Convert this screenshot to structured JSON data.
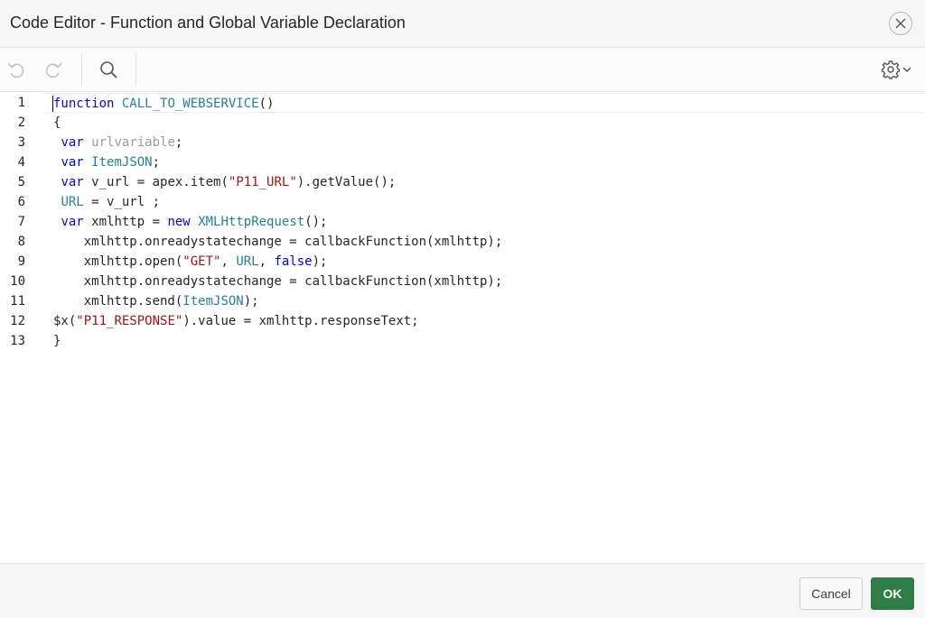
{
  "dialog": {
    "title": "Code Editor - Function and Global Variable Declaration"
  },
  "toolbar": {
    "undo_icon": "undo-icon",
    "redo_icon": "redo-icon",
    "search_icon": "search-icon",
    "settings_icon": "gear-icon"
  },
  "editor": {
    "line_numbers": [
      "1",
      "2",
      "3",
      "4",
      "5",
      "6",
      "7",
      "8",
      "9",
      "10",
      "11",
      "12",
      "13"
    ],
    "lines": [
      [
        {
          "t": "function",
          "c": "kw"
        },
        {
          "t": " "
        },
        {
          "t": "CALL_TO_WEBSERVICE",
          "c": "fn"
        },
        {
          "t": "()"
        }
      ],
      [
        {
          "t": "{"
        }
      ],
      [
        {
          "t": " "
        },
        {
          "t": "var",
          "c": "kw"
        },
        {
          "t": " "
        },
        {
          "t": "urlvariable",
          "c": "dim"
        },
        {
          "t": ";"
        }
      ],
      [
        {
          "t": " "
        },
        {
          "t": "var",
          "c": "kw"
        },
        {
          "t": " "
        },
        {
          "t": "ItemJSON",
          "c": "fn"
        },
        {
          "t": ";"
        }
      ],
      [
        {
          "t": " "
        },
        {
          "t": "var",
          "c": "kw"
        },
        {
          "t": " v_url = apex.item("
        },
        {
          "t": "\"P11_URL\"",
          "c": "str"
        },
        {
          "t": ").getValue();"
        }
      ],
      [
        {
          "t": " "
        },
        {
          "t": "URL",
          "c": "fn"
        },
        {
          "t": " = v_url ;"
        }
      ],
      [
        {
          "t": " "
        },
        {
          "t": "var",
          "c": "kw"
        },
        {
          "t": " xmlhttp = "
        },
        {
          "t": "new",
          "c": "kw"
        },
        {
          "t": " "
        },
        {
          "t": "XMLHttpRequest",
          "c": "fn"
        },
        {
          "t": "();"
        }
      ],
      [
        {
          "t": "    xmlhttp.onreadystatechange = callbackFunction(xmlhttp);"
        }
      ],
      [
        {
          "t": "    xmlhttp.open("
        },
        {
          "t": "\"GET\"",
          "c": "str"
        },
        {
          "t": ", "
        },
        {
          "t": "URL",
          "c": "fn"
        },
        {
          "t": ", "
        },
        {
          "t": "false",
          "c": "kw"
        },
        {
          "t": ");"
        }
      ],
      [
        {
          "t": "    xmlhttp.onreadystatechange = callbackFunction(xmlhttp);"
        }
      ],
      [
        {
          "t": "    xmlhttp.send("
        },
        {
          "t": "ItemJSON",
          "c": "fn"
        },
        {
          "t": ");"
        }
      ],
      [
        {
          "t": "$x("
        },
        {
          "t": "\"P11_RESPONSE\"",
          "c": "str"
        },
        {
          "t": ").value = xmlhttp.responseText;"
        }
      ],
      [
        {
          "t": "}"
        }
      ]
    ]
  },
  "footer": {
    "cancel_label": "Cancel",
    "ok_label": "OK"
  }
}
